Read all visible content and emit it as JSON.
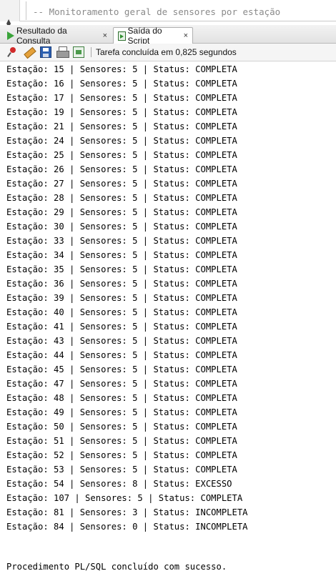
{
  "editor": {
    "comment_line": "-- Monitoramento geral de sensores por estação"
  },
  "tabs": [
    {
      "label": "Resultado da Consulta",
      "close": "×"
    },
    {
      "label": "Saída do Script",
      "close": "×"
    }
  ],
  "toolbar": {
    "status": "Tarefa concluída em 0,825 segundos"
  },
  "output": {
    "lines": [
      "Estação: 15 | Sensores: 5 | Status: COMPLETA",
      "Estação: 16 | Sensores: 5 | Status: COMPLETA",
      "Estação: 17 | Sensores: 5 | Status: COMPLETA",
      "Estação: 19 | Sensores: 5 | Status: COMPLETA",
      "Estação: 21 | Sensores: 5 | Status: COMPLETA",
      "Estação: 24 | Sensores: 5 | Status: COMPLETA",
      "Estação: 25 | Sensores: 5 | Status: COMPLETA",
      "Estação: 26 | Sensores: 5 | Status: COMPLETA",
      "Estação: 27 | Sensores: 5 | Status: COMPLETA",
      "Estação: 28 | Sensores: 5 | Status: COMPLETA",
      "Estação: 29 | Sensores: 5 | Status: COMPLETA",
      "Estação: 30 | Sensores: 5 | Status: COMPLETA",
      "Estação: 33 | Sensores: 5 | Status: COMPLETA",
      "Estação: 34 | Sensores: 5 | Status: COMPLETA",
      "Estação: 35 | Sensores: 5 | Status: COMPLETA",
      "Estação: 36 | Sensores: 5 | Status: COMPLETA",
      "Estação: 39 | Sensores: 5 | Status: COMPLETA",
      "Estação: 40 | Sensores: 5 | Status: COMPLETA",
      "Estação: 41 | Sensores: 5 | Status: COMPLETA",
      "Estação: 43 | Sensores: 5 | Status: COMPLETA",
      "Estação: 44 | Sensores: 5 | Status: COMPLETA",
      "Estação: 45 | Sensores: 5 | Status: COMPLETA",
      "Estação: 47 | Sensores: 5 | Status: COMPLETA",
      "Estação: 48 | Sensores: 5 | Status: COMPLETA",
      "Estação: 49 | Sensores: 5 | Status: COMPLETA",
      "Estação: 50 | Sensores: 5 | Status: COMPLETA",
      "Estação: 51 | Sensores: 5 | Status: COMPLETA",
      "Estação: 52 | Sensores: 5 | Status: COMPLETA",
      "Estação: 53 | Sensores: 5 | Status: COMPLETA",
      "Estação: 54 | Sensores: 8 | Status: EXCESSO",
      "Estação: 107 | Sensores: 5 | Status: COMPLETA",
      "Estação: 81 | Sensores: 3 | Status: INCOMPLETA",
      "Estação: 84 | Sensores: 0 | Status: INCOMPLETA"
    ],
    "final_message": "Procedimento PL/SQL concluído com sucesso."
  },
  "icons": {
    "tab_query": "play-icon",
    "tab_script": "script-output-icon",
    "toolbar": [
      "pin-icon",
      "eraser-icon",
      "save-icon",
      "print-icon",
      "open-file-icon"
    ]
  }
}
